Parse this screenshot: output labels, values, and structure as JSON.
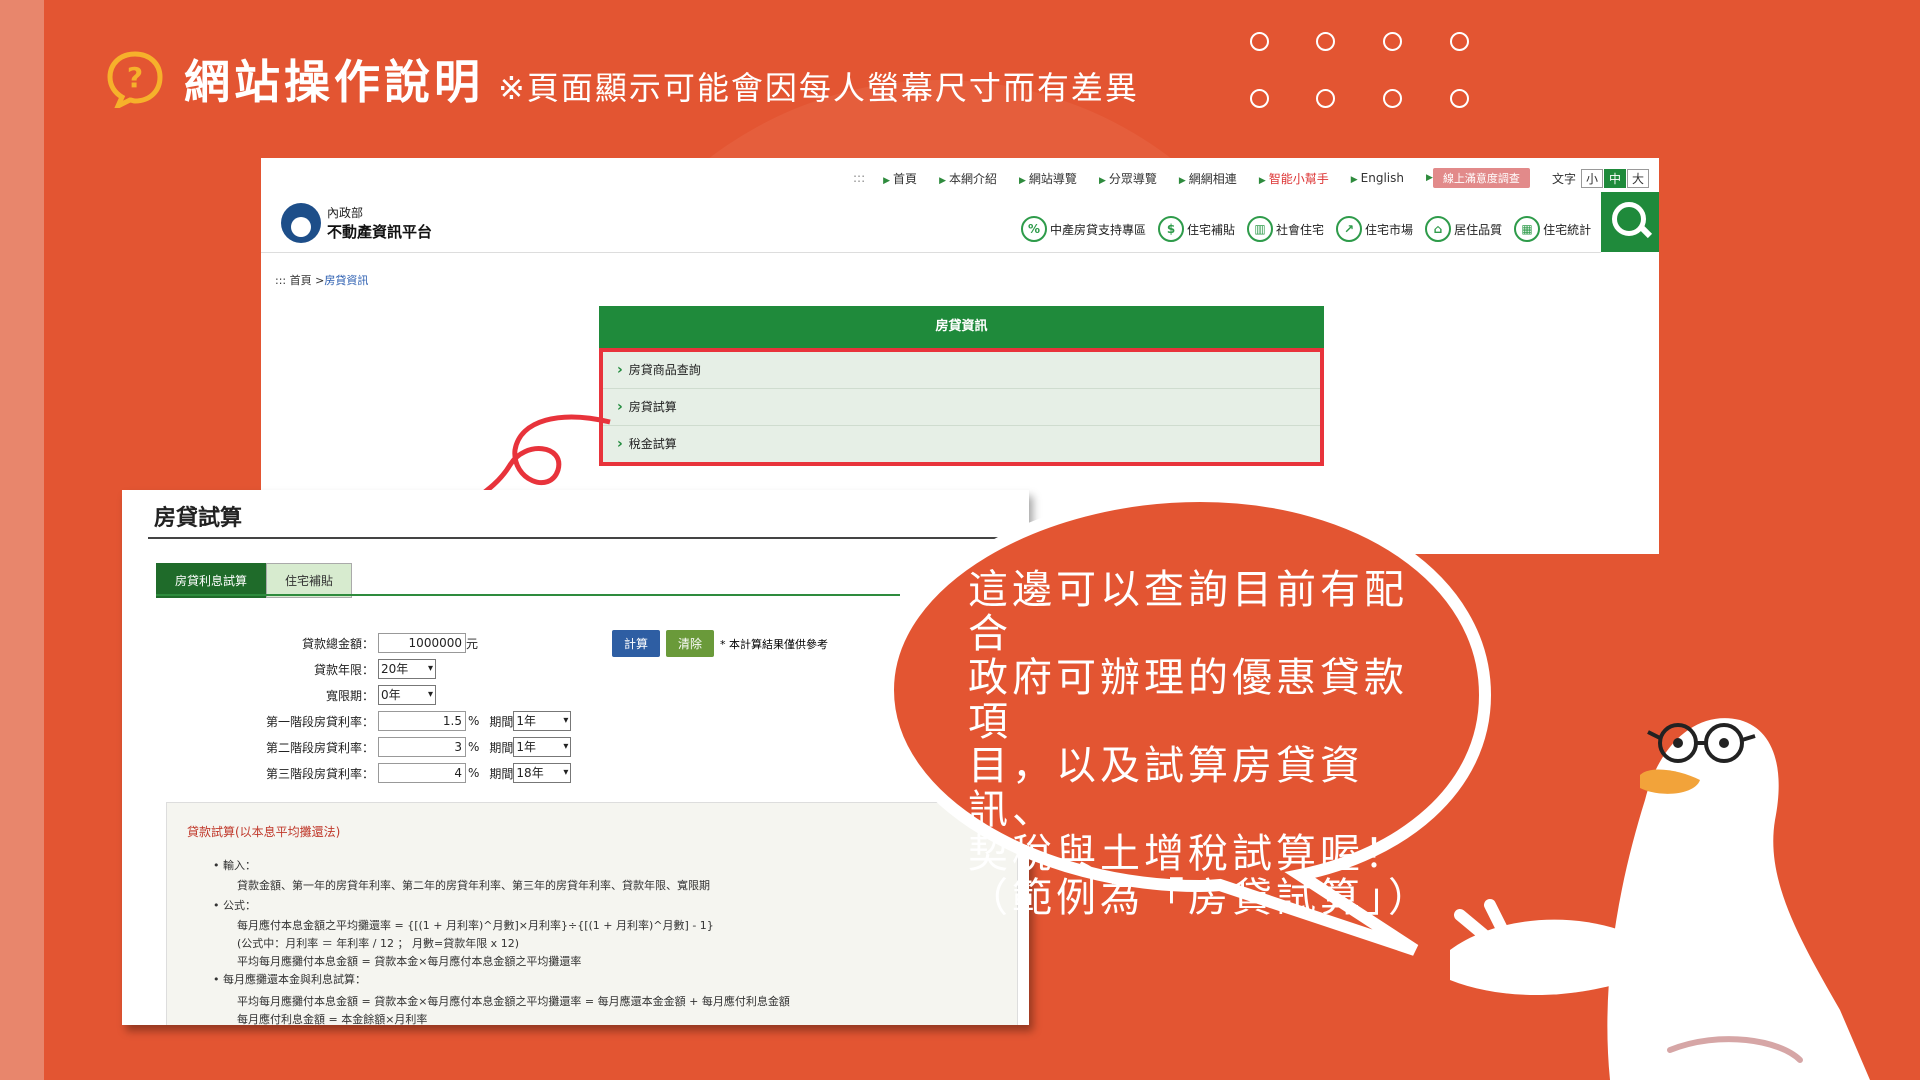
{
  "header": {
    "title": "網站操作說明",
    "subtitle": "※頁面顯示可能會因每人螢幕尺寸而有差異"
  },
  "site": {
    "topnav": {
      "prefix": ":::",
      "items": [
        "首頁",
        "本網介紹",
        "網站導覽",
        "分眾導覽",
        "網網相連",
        "智能小幫手",
        "English"
      ],
      "survey_button": "線上滿意度調查",
      "font_label": "文字",
      "font_sizes": [
        "小",
        "中",
        "大"
      ]
    },
    "logo": {
      "line1": "內政部",
      "line2": "不動產資訊平台"
    },
    "categories": [
      {
        "label": "中產房貸支持專區",
        "icon": "percent-icon"
      },
      {
        "label": "住宅補貼",
        "icon": "dollar-icon"
      },
      {
        "label": "社會住宅",
        "icon": "building-icon"
      },
      {
        "label": "住宅市場",
        "icon": "chart-icon"
      },
      {
        "label": "居住品質",
        "icon": "house-icon"
      },
      {
        "label": "住宅統計",
        "icon": "stats-icon"
      }
    ],
    "breadcrumb": {
      "prefix": ":::",
      "home": "首頁",
      "sep": ">",
      "current": "房貸資訊"
    },
    "panel": {
      "title": "房貸資訊",
      "items": [
        "房貸商品查詢",
        "房貸試算",
        "稅金試算"
      ]
    }
  },
  "calculator": {
    "heading": "房貸試算",
    "tabs": [
      "房貸利息試算",
      "住宅補貼"
    ],
    "fields": {
      "loan_amount": {
        "label": "貸款總金額：",
        "value": "1000000",
        "unit": "元"
      },
      "loan_years": {
        "label": "貸款年限：",
        "value": "20年"
      },
      "grace": {
        "label": "寬限期：",
        "value": "0年"
      },
      "rate1": {
        "label": "第一階段房貸利率：",
        "value": "1.5",
        "unit": "%",
        "period_label": "期間",
        "period": "1年"
      },
      "rate2": {
        "label": "第二階段房貸利率：",
        "value": "3",
        "unit": "%",
        "period_label": "期間",
        "period": "1年"
      },
      "rate3": {
        "label": "第三階段房貸利率：",
        "value": "4",
        "unit": "%",
        "period_label": "期間",
        "period": "18年"
      }
    },
    "calc_button": "計算",
    "clear_button": "清除",
    "note": "* 本計算結果僅供參考",
    "explain": {
      "title": "貸款試算(以本息平均攤還法)",
      "lines": [
        "• 輸入：",
        "貸款金額、第一年的房貸年利率、第二年的房貸年利率、第三年的房貸年利率、貸款年限、寬限期",
        "• 公式：",
        "每月應付本息金額之平均攤還率 = {[(1 + 月利率)^月數]×月利率}÷{[(1 + 月利率)^月數] - 1}",
        "(公式中：月利率 ＝ 年利率 / 12 ； 月數=貸款年限 x 12)",
        "平均每月應攤付本息金額 = 貸款本金×每月應付本息金額之平均攤還率",
        "• 每月應攤還本金與利息試算：",
        "平均每月應攤付本息金額 = 貸款本金×每月應付本息金額之平均攤還率 = 每月應還本金金額 + 每月應付利息金額",
        "每月應付利息金額 = 本金餘額×月利率"
      ]
    }
  },
  "bubble": {
    "lines": [
      "這邊可以查詢目前有配合",
      "政府可辦理的優惠貸款項",
      "目，以及試算房貸資訊、",
      "契稅與土增稅試算喔！",
      "（範例為「房貸試算」）"
    ]
  }
}
